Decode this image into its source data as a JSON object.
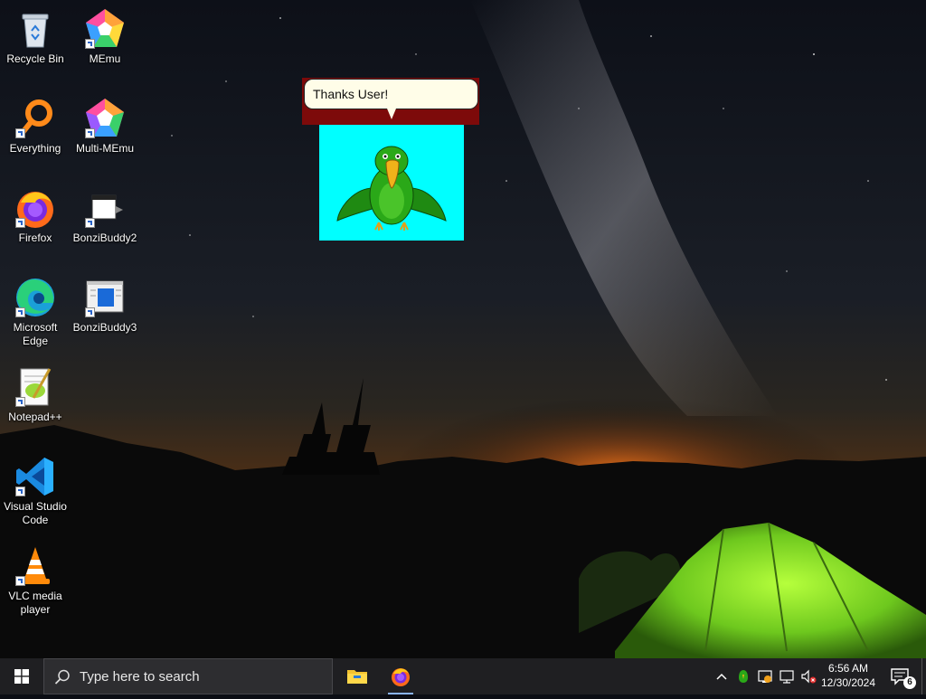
{
  "desktop": {
    "icons": [
      {
        "label": "Recycle Bin",
        "icon": "recycle-bin-icon"
      },
      {
        "label": "MEmu",
        "icon": "memu-icon"
      },
      {
        "label": "Everything",
        "icon": "everything-icon"
      },
      {
        "label": "Multi-MEmu",
        "icon": "multi-memu-icon"
      },
      {
        "label": "Firefox",
        "icon": "firefox-icon"
      },
      {
        "label": "BonziBuddy2",
        "icon": "bonzibuddy2-icon"
      },
      {
        "label": "Microsoft Edge",
        "icon": "edge-icon"
      },
      {
        "label": "BonziBuddy3",
        "icon": "bonzibuddy3-icon"
      },
      {
        "label": "Notepad++",
        "icon": "notepadpp-icon"
      },
      {
        "label": "Visual Studio Code",
        "icon": "vscode-icon"
      },
      {
        "label": "VLC media player",
        "icon": "vlc-icon"
      }
    ]
  },
  "agent": {
    "speech": "Thanks User!",
    "character": "green-parrot",
    "frame_color": "#00ffff",
    "band_color": "#7d0a0a"
  },
  "taskbar": {
    "search_placeholder": "Type here to search",
    "apps": [
      {
        "name": "File Explorer",
        "icon": "folder-icon",
        "active": false
      },
      {
        "name": "Firefox",
        "icon": "firefox-icon",
        "active": true
      }
    ],
    "tray": [
      "chevron-up-icon",
      "bonzi-tray-icon",
      "security-icon",
      "network-icon",
      "volume-muted-icon"
    ],
    "time": "6:56 AM",
    "date": "12/30/2024",
    "notification_count": "6"
  }
}
